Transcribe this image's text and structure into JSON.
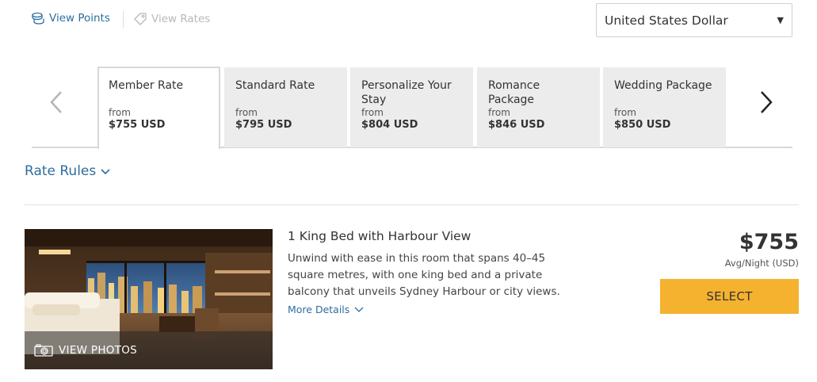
{
  "top_links": {
    "view_points": "View Points",
    "view_rates": "View Rates"
  },
  "currency": {
    "selected": "United States Dollar"
  },
  "tabs": [
    {
      "name": "Member Rate",
      "from": "from",
      "price": "$755 USD",
      "active": true
    },
    {
      "name": "Standard Rate",
      "from": "from",
      "price": "$795 USD",
      "active": false
    },
    {
      "name": "Personalize Your Stay",
      "from": "from",
      "price": "$804 USD",
      "active": false
    },
    {
      "name": "Romance Package",
      "from": "from",
      "price": "$846 USD",
      "active": false
    },
    {
      "name": "Wedding Package",
      "from": "from",
      "price": "$850 USD",
      "active": false
    }
  ],
  "rate_rules": "Rate Rules",
  "room": {
    "title": "1 King Bed with Harbour View",
    "description": "Unwind with ease in this room that spans 40–45 square metres, with one king bed and a private balcony that unveils Sydney Harbour or city views.",
    "more_details": "More Details",
    "view_photos": "VIEW PHOTOS",
    "price": "$755",
    "price_note": "Avg/Night (USD)",
    "select_label": "SELECT"
  },
  "colors": {
    "link": "#2d6e9e",
    "select_button": "#f4b22f",
    "inactive_tab": "#ececec"
  }
}
